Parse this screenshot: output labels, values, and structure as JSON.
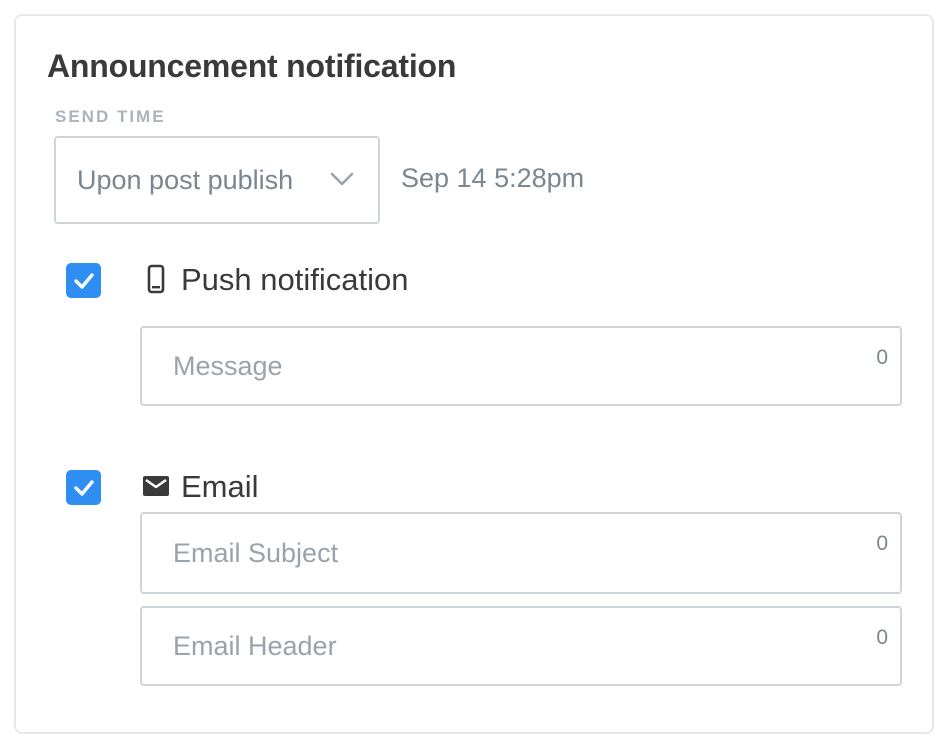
{
  "announcement": {
    "title": "Announcement notification",
    "send_time_label": "SEND TIME",
    "send_time_selected": "Upon post publish",
    "send_time_date": "Sep 14 5:28pm"
  },
  "push": {
    "checked": true,
    "label": "Push notification",
    "icon": "phone-icon",
    "message_placeholder": "Message",
    "message_value": "",
    "message_count": "0"
  },
  "email": {
    "checked": true,
    "label": "Email",
    "icon": "mail-icon",
    "subject_placeholder": "Email Subject",
    "subject_value": "",
    "subject_count": "0",
    "header_placeholder": "Email Header",
    "header_value": "",
    "header_count": "0"
  },
  "colors": {
    "accent": "#2e8ef2",
    "title_text": "#3a3a3a",
    "muted_text": "#7a8690",
    "border": "#cfd4d9"
  }
}
